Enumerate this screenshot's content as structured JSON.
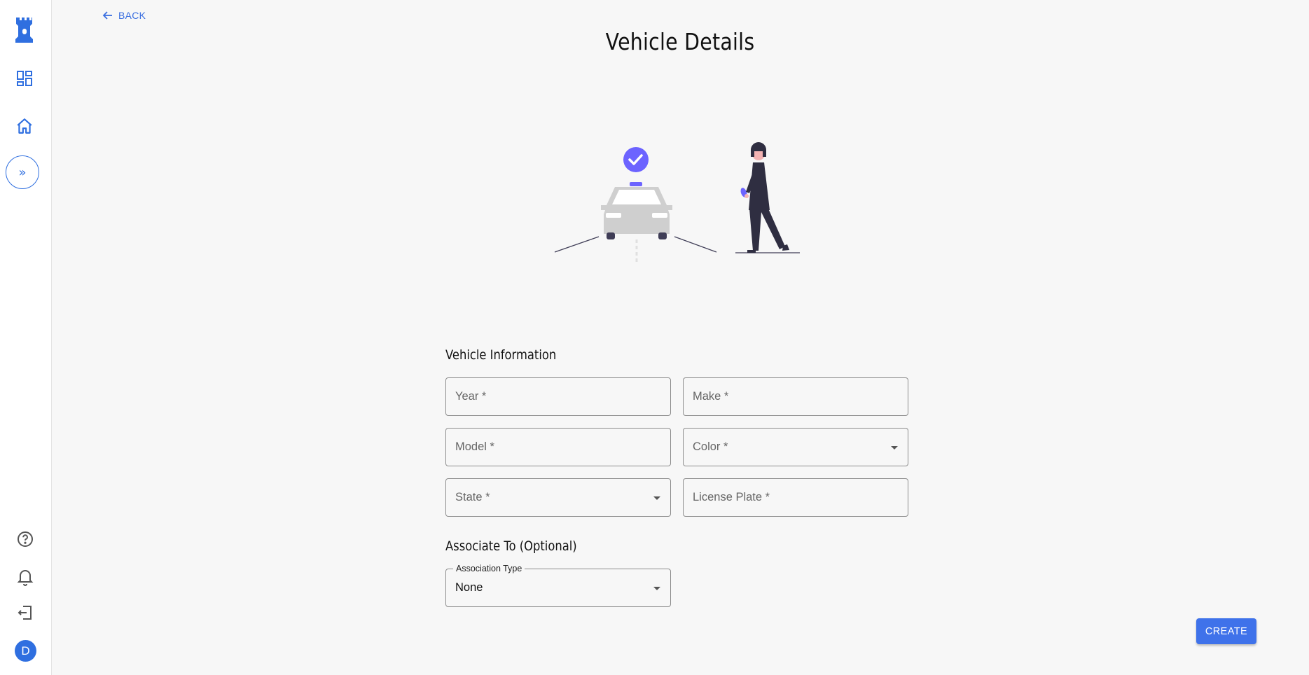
{
  "header": {
    "back_label": "BACK",
    "title": "Vehicle Details"
  },
  "sidebar": {
    "icons": [
      "castle-logo-icon",
      "dashboard-icon",
      "home-icon",
      "expand-icon",
      "help-icon",
      "bell-icon",
      "logout-icon"
    ],
    "avatar_initial": "D"
  },
  "vehicle_info": {
    "heading": "Vehicle Information",
    "year_label": "Year *",
    "make_label": "Make *",
    "model_label": "Model *",
    "color_label": "Color *",
    "state_label": "State *",
    "license_label": "License Plate *"
  },
  "association": {
    "heading": "Associate To (Optional)",
    "type_label": "Association Type",
    "type_value": "None"
  },
  "actions": {
    "create_label": "CREATE"
  },
  "colors": {
    "accent": "#3f72ea",
    "illustration_accent": "#6c63ff"
  }
}
